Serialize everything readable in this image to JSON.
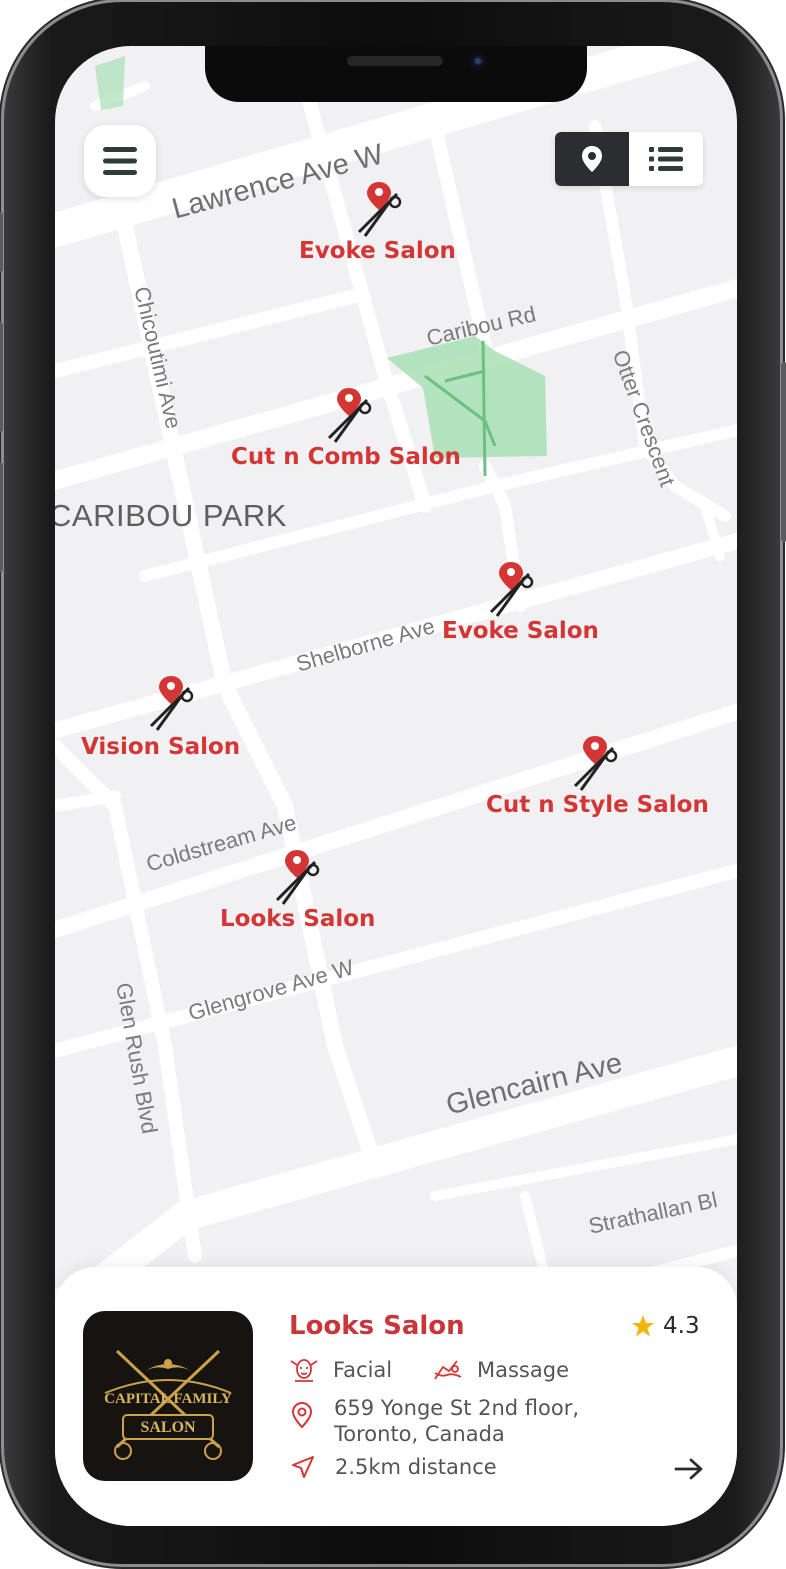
{
  "map": {
    "area_label": "CARIBOU PARK",
    "streets": {
      "lawrence": "Lawrence Ave W",
      "caribou": "Caribou Rd",
      "chicoutimi": "Chicoutimi Ave",
      "otter": "Otter Crescent",
      "shelborne": "Shelborne Ave",
      "coldstream": "Coldstream Ave",
      "glengrove": "Glengrove Ave W",
      "glen_rush": "Glen Rush Blvd",
      "glencairn": "Glencairn Ave",
      "strathallan": "Strathallan Bl"
    },
    "salons": [
      {
        "name": "Evoke Salon"
      },
      {
        "name": "Cut n Comb Salon"
      },
      {
        "name": "Evoke Salon"
      },
      {
        "name": "Vision Salon"
      },
      {
        "name": "Cut n Style Salon"
      },
      {
        "name": "Looks Salon"
      }
    ]
  },
  "controls": {
    "menu_icon": "hamburger-menu-icon",
    "map_view_icon": "map-pin-icon",
    "list_view_icon": "list-icon",
    "active_view": "map"
  },
  "card": {
    "logo": {
      "line1": "CAPITAL FAMILY",
      "line2": "SALON"
    },
    "title": "Looks Salon",
    "rating": "4.3",
    "services": [
      "Facial",
      "Massage"
    ],
    "address": "659 Yonge St 2nd floor, Toronto, Canada",
    "distance": "2.5km distance"
  },
  "colors": {
    "accent": "#d43636",
    "star": "#f5b50a",
    "map_bg": "#f1f1f3",
    "road": "#ffffff",
    "park": "#a8dfb4",
    "dark": "#2b2d30"
  }
}
